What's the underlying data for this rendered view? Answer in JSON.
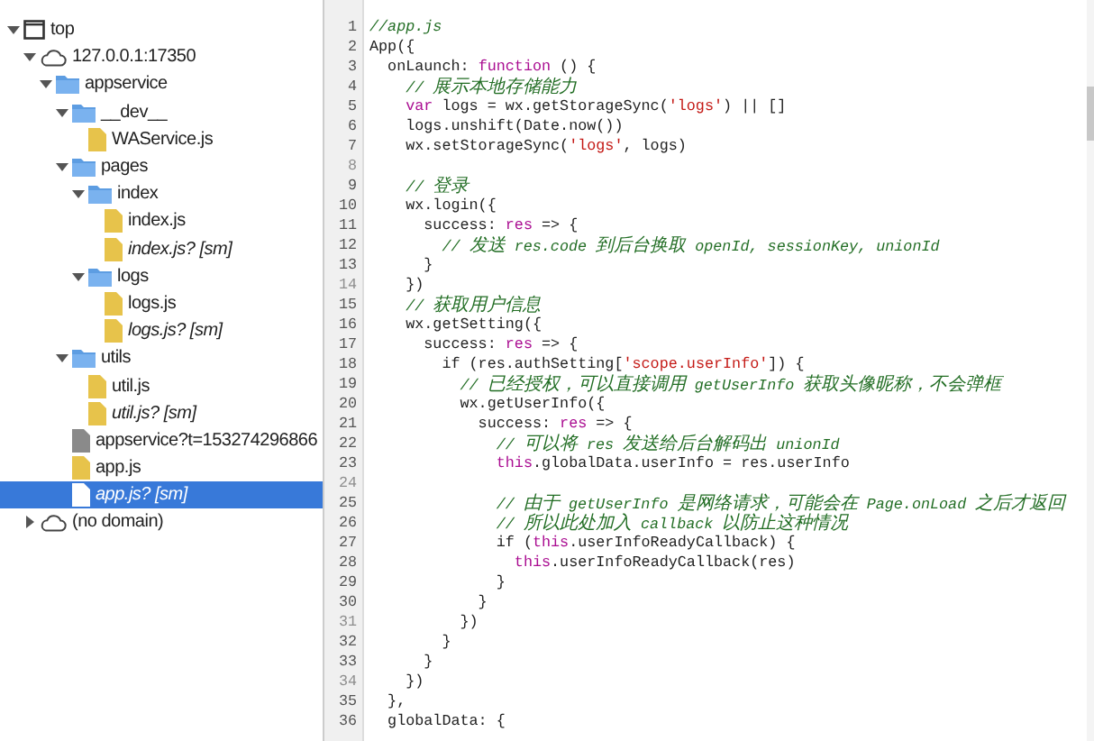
{
  "tree": [
    {
      "label": "top",
      "kind": "frame",
      "expanded": true,
      "selected": false,
      "children": [
        {
          "label": "127.0.0.1:17350",
          "kind": "domain",
          "expanded": true,
          "selected": false,
          "children": [
            {
              "label": "appservice",
              "kind": "folder",
              "expanded": true,
              "selected": false,
              "children": [
                {
                  "label": "__dev__",
                  "kind": "folder",
                  "expanded": true,
                  "selected": false,
                  "children": [
                    {
                      "label": "WAService.js",
                      "kind": "script",
                      "selected": false
                    }
                  ]
                },
                {
                  "label": "pages",
                  "kind": "folder",
                  "expanded": true,
                  "selected": false,
                  "children": [
                    {
                      "label": "index",
                      "kind": "folder",
                      "expanded": true,
                      "selected": false,
                      "children": [
                        {
                          "label": "index.js",
                          "kind": "script",
                          "selected": false
                        },
                        {
                          "label": "index.js? [sm]",
                          "kind": "sourcemap",
                          "selected": false
                        }
                      ]
                    },
                    {
                      "label": "logs",
                      "kind": "folder",
                      "expanded": true,
                      "selected": false,
                      "children": [
                        {
                          "label": "logs.js",
                          "kind": "script",
                          "selected": false
                        },
                        {
                          "label": "logs.js? [sm]",
                          "kind": "sourcemap",
                          "selected": false
                        }
                      ]
                    }
                  ]
                },
                {
                  "label": "utils",
                  "kind": "folder",
                  "expanded": true,
                  "selected": false,
                  "children": [
                    {
                      "label": "util.js",
                      "kind": "script",
                      "selected": false
                    },
                    {
                      "label": "util.js? [sm]",
                      "kind": "sourcemap",
                      "selected": false
                    }
                  ]
                },
                {
                  "label": "appservice?t=153274296866",
                  "kind": "document",
                  "selected": false
                },
                {
                  "label": "app.js",
                  "kind": "script",
                  "selected": false
                },
                {
                  "label": "app.js? [sm]",
                  "kind": "sourcemap",
                  "selected": true
                }
              ]
            }
          ]
        },
        {
          "label": "(no domain)",
          "kind": "domain",
          "expanded": false,
          "selected": false
        }
      ]
    }
  ],
  "editor": {
    "lines": [
      {
        "number": "1",
        "dim": false,
        "tokens": [
          {
            "kind": "comment",
            "text": "//app.js"
          }
        ]
      },
      {
        "number": "2",
        "dim": false,
        "tokens": [
          {
            "kind": "plain",
            "text": "App({"
          }
        ]
      },
      {
        "number": "3",
        "dim": false,
        "tokens": [
          {
            "kind": "plain",
            "text": "  onLaunch: "
          },
          {
            "kind": "keyword",
            "text": "function"
          },
          {
            "kind": "plain",
            "text": " () {"
          }
        ]
      },
      {
        "number": "4",
        "dim": false,
        "tokens": [
          {
            "kind": "comment",
            "text": "    // 展示本地存储能力"
          }
        ]
      },
      {
        "number": "5",
        "dim": false,
        "tokens": [
          {
            "kind": "keyword",
            "text": "    var"
          },
          {
            "kind": "plain",
            "text": " logs = wx.getStorageSync("
          },
          {
            "kind": "string",
            "text": "'logs'"
          },
          {
            "kind": "plain",
            "text": ") || []"
          }
        ]
      },
      {
        "number": "6",
        "dim": false,
        "tokens": [
          {
            "kind": "plain",
            "text": "    logs.unshift(Date.now())"
          }
        ]
      },
      {
        "number": "7",
        "dim": false,
        "tokens": [
          {
            "kind": "plain",
            "text": "    wx.setStorageSync("
          },
          {
            "kind": "string",
            "text": "'logs'"
          },
          {
            "kind": "plain",
            "text": ", logs)"
          }
        ]
      },
      {
        "number": "8",
        "dim": true
      },
      {
        "number": "9",
        "dim": false,
        "tokens": [
          {
            "kind": "comment",
            "text": "    // 登录"
          }
        ]
      },
      {
        "number": "10",
        "dim": false,
        "tokens": [
          {
            "kind": "plain",
            "text": "    wx.login({"
          }
        ]
      },
      {
        "number": "11",
        "dim": false,
        "tokens": [
          {
            "kind": "plain",
            "text": "      success: "
          },
          {
            "kind": "variable",
            "text": "res"
          },
          {
            "kind": "plain",
            "text": " => {"
          }
        ]
      },
      {
        "number": "12",
        "dim": false,
        "tokens": [
          {
            "kind": "comment",
            "text": "        // 发送 res.code 到后台换取 openId, sessionKey, unionId"
          }
        ]
      },
      {
        "number": "13",
        "dim": false,
        "tokens": [
          {
            "kind": "plain",
            "text": "      }"
          }
        ]
      },
      {
        "number": "14",
        "dim": true,
        "tokens": [
          {
            "kind": "plain",
            "text": "    })"
          }
        ]
      },
      {
        "number": "15",
        "dim": false,
        "tokens": [
          {
            "kind": "comment",
            "text": "    // 获取用户信息"
          }
        ]
      },
      {
        "number": "16",
        "dim": false,
        "tokens": [
          {
            "kind": "plain",
            "text": "    wx.getSetting({"
          }
        ]
      },
      {
        "number": "17",
        "dim": false,
        "tokens": [
          {
            "kind": "plain",
            "text": "      success: "
          },
          {
            "kind": "variable",
            "text": "res"
          },
          {
            "kind": "plain",
            "text": " => {"
          }
        ]
      },
      {
        "number": "18",
        "dim": false,
        "tokens": [
          {
            "kind": "plain",
            "text": "        if (res.authSetting["
          },
          {
            "kind": "string",
            "text": "'scope.userInfo'"
          },
          {
            "kind": "plain",
            "text": "]) {"
          }
        ]
      },
      {
        "number": "19",
        "dim": false,
        "tokens": [
          {
            "kind": "comment",
            "text": "          // 已经授权，可以直接调用 getUserInfo 获取头像昵称，不会弹框"
          }
        ]
      },
      {
        "number": "20",
        "dim": false,
        "tokens": [
          {
            "kind": "plain",
            "text": "          wx.getUserInfo({"
          }
        ]
      },
      {
        "number": "21",
        "dim": false,
        "tokens": [
          {
            "kind": "plain",
            "text": "            success: "
          },
          {
            "kind": "variable",
            "text": "res"
          },
          {
            "kind": "plain",
            "text": " => {"
          }
        ]
      },
      {
        "number": "22",
        "dim": false,
        "tokens": [
          {
            "kind": "comment",
            "text": "              // 可以将 res 发送给后台解码出 unionId"
          }
        ]
      },
      {
        "number": "23",
        "dim": false,
        "tokens": [
          {
            "kind": "variable",
            "text": "              this"
          },
          {
            "kind": "plain",
            "text": ".globalData.userInfo = res.userInfo"
          }
        ]
      },
      {
        "number": "24",
        "dim": true
      },
      {
        "number": "25",
        "dim": false,
        "tokens": [
          {
            "kind": "comment",
            "text": "              // 由于 getUserInfo 是网络请求，可能会在 Page.onLoad 之后才返回"
          }
        ]
      },
      {
        "number": "26",
        "dim": false,
        "tokens": [
          {
            "kind": "comment",
            "text": "              // 所以此处加入 callback 以防止这种情况"
          }
        ]
      },
      {
        "number": "27",
        "dim": false,
        "tokens": [
          {
            "kind": "plain",
            "text": "              if ("
          },
          {
            "kind": "variable",
            "text": "this"
          },
          {
            "kind": "plain",
            "text": ".userInfoReadyCallback) {"
          }
        ]
      },
      {
        "number": "28",
        "dim": false,
        "tokens": [
          {
            "kind": "variable",
            "text": "                this"
          },
          {
            "kind": "plain",
            "text": ".userInfoReadyCallback(res)"
          }
        ]
      },
      {
        "number": "29",
        "dim": false,
        "tokens": [
          {
            "kind": "plain",
            "text": "              }"
          }
        ]
      },
      {
        "number": "30",
        "dim": false,
        "tokens": [
          {
            "kind": "plain",
            "text": "            }"
          }
        ]
      },
      {
        "number": "31",
        "dim": true,
        "tokens": [
          {
            "kind": "plain",
            "text": "          })"
          }
        ]
      },
      {
        "number": "32",
        "dim": false,
        "tokens": [
          {
            "kind": "plain",
            "text": "        }"
          }
        ]
      },
      {
        "number": "33",
        "dim": false,
        "tokens": [
          {
            "kind": "plain",
            "text": "      }"
          }
        ]
      },
      {
        "number": "34",
        "dim": true,
        "tokens": [
          {
            "kind": "plain",
            "text": "    })"
          }
        ]
      },
      {
        "number": "35",
        "dim": false,
        "tokens": [
          {
            "kind": "plain",
            "text": "  },"
          }
        ]
      },
      {
        "number": "36",
        "dim": false,
        "tokens": [
          {
            "kind": "plain",
            "text": "  globalData: {"
          }
        ]
      }
    ]
  }
}
